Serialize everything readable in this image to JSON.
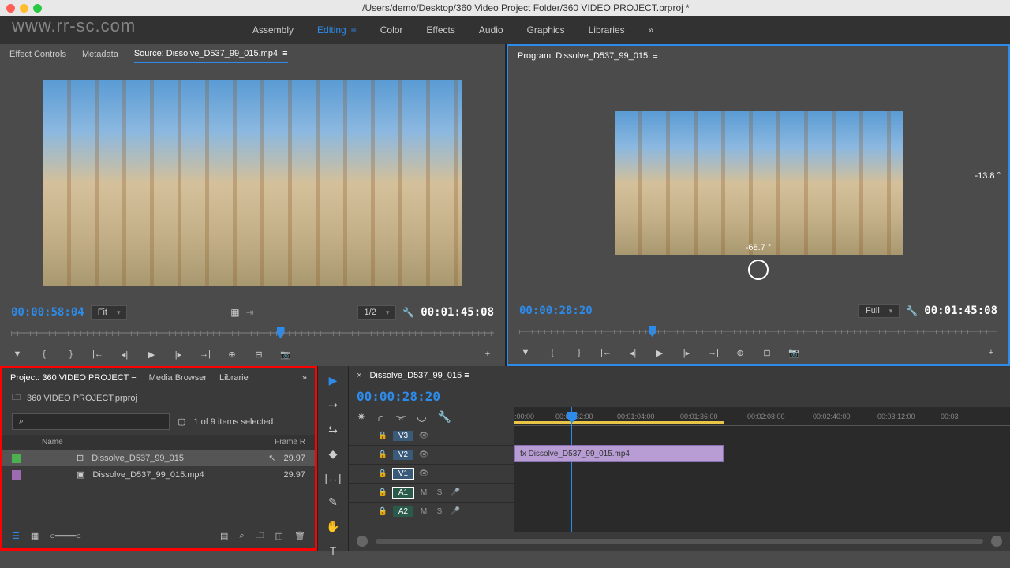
{
  "titlebar": "/Users/demo/Desktop/360 Video Project Folder/360 VIDEO PROJECT.prproj *",
  "watermark": "www.rr-sc.com",
  "workspaces": {
    "assembly": "Assembly",
    "editing": "Editing",
    "color": "Color",
    "effects": "Effects",
    "audio": "Audio",
    "graphics": "Graphics",
    "libraries": "Libraries"
  },
  "source": {
    "tabs": {
      "effectControls": "Effect Controls",
      "metadata": "Metadata",
      "source": "Source: Dissolve_D537_99_015.mp4"
    },
    "timecode_in": "00:00:58:04",
    "fit": "Fit",
    "zoom": "1/2",
    "timecode_out": "00:01:45:08"
  },
  "program": {
    "title": "Program: Dissolve_D537_99_015",
    "vr_angle1": "-13.8 °",
    "vr_angle2": "-68.7 °",
    "timecode_in": "00:00:28:20",
    "fit": "Full",
    "timecode_out": "00:01:45:08"
  },
  "project": {
    "tabs": {
      "project": "Project: 360 VIDEO PROJECT",
      "mediaBrowser": "Media Browser",
      "libraries": "Librarie"
    },
    "filename": "360 VIDEO PROJECT.prproj",
    "status": "1 of 9 items selected",
    "headers": {
      "name": "Name",
      "framerate": "Frame R"
    },
    "items": [
      {
        "color": "#4caf50",
        "name": "Dissolve_D537_99_015",
        "rate": "29.97",
        "selected": true
      },
      {
        "color": "#9c6bb0",
        "name": "Dissolve_D537_99_015.mp4",
        "rate": "29.97",
        "selected": false
      }
    ]
  },
  "timeline": {
    "sequence": "Dissolve_D537_99_015",
    "timecode": "00:00:28:20",
    "ruler": [
      ":00:00",
      "00:00:32:00",
      "00:01:04:00",
      "00:01:36:00",
      "00:02:08:00",
      "00:02:40:00",
      "00:03:12:00",
      "00:03"
    ],
    "tracks": {
      "v3": "V3",
      "v2": "V2",
      "v1": "V1",
      "a1": "A1",
      "a2": "A2"
    },
    "clip_name": "Dissolve_D537_99_015.mp4",
    "track_letters": {
      "m": "M",
      "s": "S"
    }
  }
}
